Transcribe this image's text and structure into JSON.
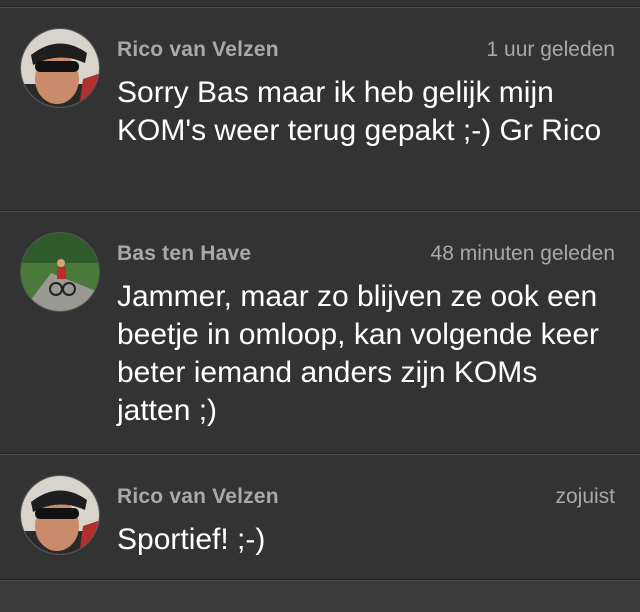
{
  "comments": [
    {
      "author": "Rico van Velzen",
      "time": "1 uur geleden",
      "text": "Sorry Bas maar ik heb gelijk mijn KOM's weer terug gepakt ;-) Gr Rico",
      "avatar_icon": "cyclist-helmet-avatar"
    },
    {
      "author": "Bas ten Have",
      "time": "48 minuten geleden",
      "text": "Jammer, maar zo blijven ze ook een beetje in omloop, kan volgende keer beter iemand anders zijn KOMs jatten ;)",
      "avatar_icon": "cyclist-road-avatar"
    },
    {
      "author": "Rico van Velzen",
      "time": "zojuist",
      "text": "Sportief! ;-)",
      "avatar_icon": "cyclist-helmet-avatar"
    }
  ]
}
